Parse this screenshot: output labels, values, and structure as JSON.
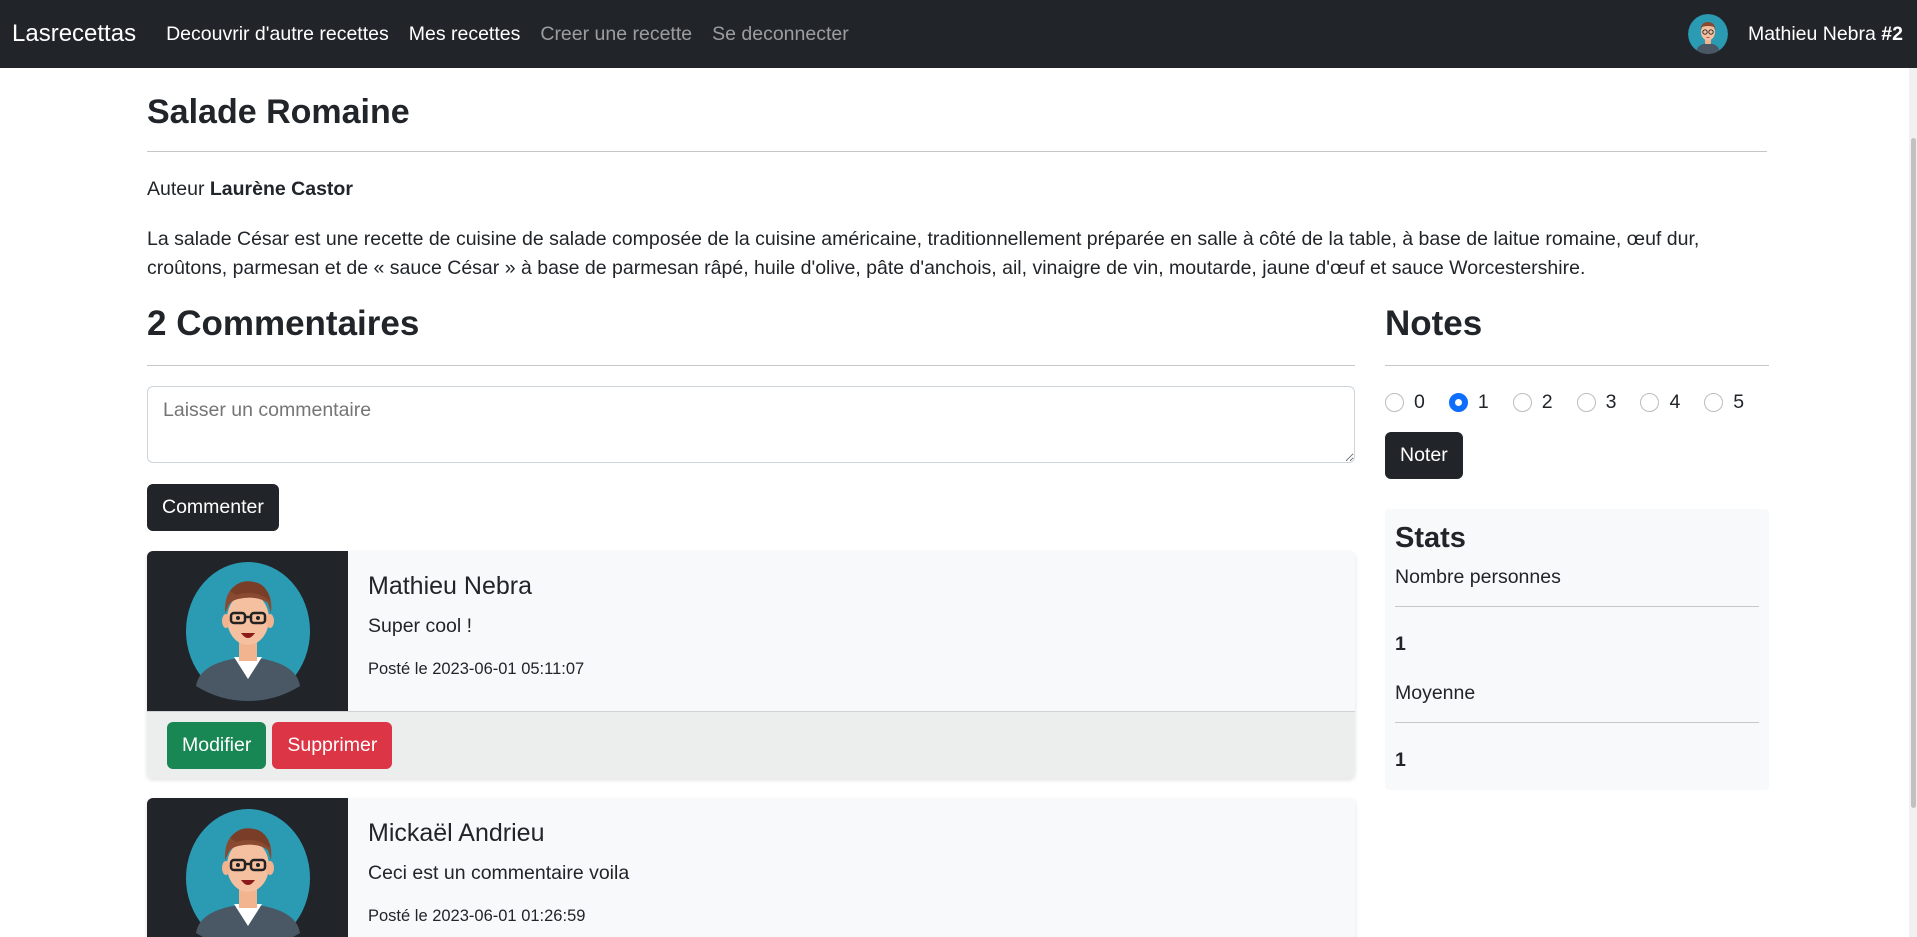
{
  "navbar": {
    "brand": "Lasrecettas",
    "links": [
      {
        "label": "Decouvrir d'autre recettes"
      },
      {
        "label": "Mes recettes"
      },
      {
        "label": "Creer une recette"
      },
      {
        "label": "Se deconnecter"
      }
    ],
    "user_name": "Mathieu Nebra",
    "user_id": "#2"
  },
  "recipe": {
    "title": "Salade Romaine",
    "author_prefix": "Auteur",
    "author_name": "Laurène Castor",
    "description": "La salade César est une recette de cuisine de salade composée de la cuisine américaine, traditionnellement préparée en salle à côté de la table, à base de laitue romaine, œuf dur, croûtons, parmesan et de « sauce César » à base de parmesan râpé, huile d'olive, pâte d'anchois, ail, vinaigre de vin, moutarde, jaune d'œuf et sauce Worcestershire."
  },
  "comments": {
    "heading": "2 Commentaires",
    "input_placeholder": "Laisser un commentaire",
    "submit_label": "Commenter",
    "items": [
      {
        "author": "Mathieu Nebra",
        "text": "Super cool !",
        "date": "Posté le 2023-06-01 05:11:07",
        "edit_label": "Modifier",
        "delete_label": "Supprimer"
      },
      {
        "author": "Mickaël Andrieu",
        "text": "Ceci est un commentaire voila",
        "date": "Posté le 2023-06-01 01:26:59"
      }
    ]
  },
  "notes": {
    "heading": "Notes",
    "options": [
      "0",
      "1",
      "2",
      "3",
      "4",
      "5"
    ],
    "selected": "1",
    "submit_label": "Noter"
  },
  "stats": {
    "title": "Stats",
    "count_label": "Nombre personnes",
    "count_value": "1",
    "avg_label": "Moyenne",
    "avg_value": "1"
  },
  "colors": {
    "navbar_bg": "#212529",
    "radio_checked": "#0d6efd",
    "btn_success": "#198754",
    "btn_danger": "#dc3545"
  }
}
